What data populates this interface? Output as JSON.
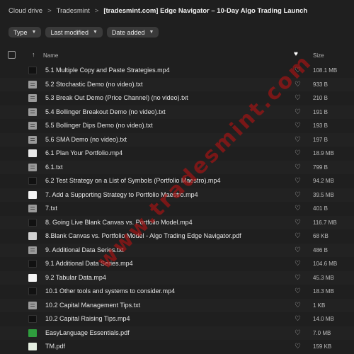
{
  "breadcrumb": {
    "root": "Cloud drive",
    "parent": "Tradesmint",
    "current": "[tradesmint.com] Edge Navigator – 10-Day Algo Trading Launch",
    "separator": ">"
  },
  "filters": [
    {
      "label": "Type"
    },
    {
      "label": "Last modified"
    },
    {
      "label": "Date added"
    }
  ],
  "table_header": {
    "sort_arrow": "↑",
    "name": "Name",
    "favourite_icon": "heart-icon",
    "size": "Size"
  },
  "files": [
    {
      "name": "5.1 Multiple Copy and Paste Strategies.mp4",
      "size": "108.1 MB",
      "thumb": "vid-dark"
    },
    {
      "name": "5.2 Stochastic Demo (no video).txt",
      "size": "933 B",
      "thumb": "doc"
    },
    {
      "name": "5.3 Break Out Demo (Price Channel) (no video).txt",
      "size": "210 B",
      "thumb": "doc"
    },
    {
      "name": "5.4 Bollinger Breakout Demo (no video).txt",
      "size": "191 B",
      "thumb": "doc"
    },
    {
      "name": "5.5 Bollinger Dips Demo (no video).txt",
      "size": "193 B",
      "thumb": "doc"
    },
    {
      "name": "5.6 SMA Demo (no video).txt",
      "size": "197 B",
      "thumb": "doc"
    },
    {
      "name": "6.1 Plan Your Portfolio.mp4",
      "size": "18.9 MB",
      "thumb": "vid-light"
    },
    {
      "name": "6.1.txt",
      "size": "799 B",
      "thumb": "doc"
    },
    {
      "name": "6.2 Test Strategy on a List of Symbols (Portfolio Maestro).mp4",
      "size": "94.2 MB",
      "thumb": "vid-dark"
    },
    {
      "name": "7. Add a Supporting Strategy to Portfolio Maestro.mp4",
      "size": "39.5 MB",
      "thumb": "vid-white"
    },
    {
      "name": "7.txt",
      "size": "401 B",
      "thumb": "doc"
    },
    {
      "name": "8. Going Live Blank Canvas vs. Portfolio Model.mp4",
      "size": "116.7 MB",
      "thumb": "vid-dark"
    },
    {
      "name": "8.Blank Canvas vs. Portfolio Model - Algo Trading Edge Navigator.pdf",
      "size": "68 KB",
      "thumb": "pdf-doc"
    },
    {
      "name": "9. Additional Data Series.txt",
      "size": "486 B",
      "thumb": "doc"
    },
    {
      "name": "9.1 Additional Data Series.mp4",
      "size": "104.6 MB",
      "thumb": "vid-dark"
    },
    {
      "name": "9.2 Tabular Data.mp4",
      "size": "45.3 MB",
      "thumb": "vid-white"
    },
    {
      "name": "10.1 Other tools and systems to consider.mp4",
      "size": "18.3 MB",
      "thumb": "vid-dark"
    },
    {
      "name": "10.2 Capital Management Tips.txt",
      "size": "1 KB",
      "thumb": "doc"
    },
    {
      "name": "10.2 Capital Raising Tips.mp4",
      "size": "14.0 MB",
      "thumb": "vid-dark"
    },
    {
      "name": "EasyLanguage Essentials.pdf",
      "size": "7.0 MB",
      "thumb": "pdf-green"
    },
    {
      "name": "TM.pdf",
      "size": "159 KB",
      "thumb": "pdf-light"
    }
  ],
  "watermark": "www.tradesmint.com",
  "colors": {
    "background": "#1f1f1f",
    "chip": "#3a3a3a",
    "watermark": "#aa1414"
  }
}
